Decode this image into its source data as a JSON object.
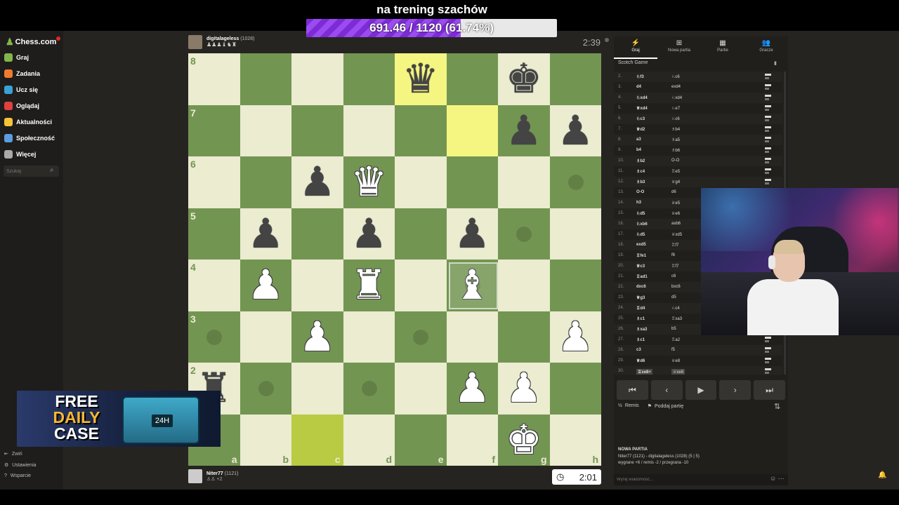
{
  "stream": {
    "title": "na trening szachów",
    "goal_text": "691.46 / 1120 (61.74%)",
    "goal_fraction": 0.6174
  },
  "sidebar": {
    "logo": "Chess.com",
    "items": [
      {
        "label": "Graj",
        "color": "#81b64c"
      },
      {
        "label": "Zadania",
        "color": "#f07b2e"
      },
      {
        "label": "Ucz się",
        "color": "#3aa1d8"
      },
      {
        "label": "Oglądaj",
        "color": "#e04040"
      },
      {
        "label": "Aktualności",
        "color": "#f6c33a"
      },
      {
        "label": "Społeczność",
        "color": "#5b9ee0"
      },
      {
        "label": "Więcej",
        "color": "#aaaaaa"
      }
    ],
    "search_placeholder": "Szukaj",
    "footer": [
      {
        "label": "Zwiń"
      },
      {
        "label": "Ustawienia"
      },
      {
        "label": "Wsparcie"
      }
    ]
  },
  "ad": {
    "line1": "FREE",
    "line2": "DAILY",
    "line3": "CASE",
    "box_label": "24H"
  },
  "top_player": {
    "name": "digitalageless",
    "rating": "(1028)",
    "clock": "2:39"
  },
  "bottom_player": {
    "name": "Niter77",
    "rating": "(1121)",
    "score": "+2",
    "clock": "2:01"
  },
  "board": {
    "ranks": [
      "8",
      "7",
      "6",
      "5",
      "4",
      "3",
      "2",
      "1"
    ],
    "files": [
      "a",
      "b",
      "c",
      "d",
      "e",
      "f",
      "g",
      "h"
    ],
    "highlights": [
      "e8",
      "f7"
    ],
    "last_highlight": [
      "c1"
    ],
    "dots": [
      "h6",
      "g5",
      "f4",
      "a3",
      "e3",
      "b2",
      "d2"
    ],
    "pieces": {
      "e8": "bq",
      "g8": "bk",
      "g7": "bp",
      "h7": "bp",
      "c6": "bp",
      "d6": "wq",
      "b5": "bp",
      "d5": "bp",
      "f5": "bp",
      "b4": "wp",
      "d4": "wr",
      "f4": "wb",
      "c3": "wp",
      "h3": "wp",
      "a2": "br",
      "f2": "wp",
      "g2": "wp",
      "g1": "wk"
    }
  },
  "panel": {
    "tabs": [
      {
        "label": "Graj",
        "icon": "⚡"
      },
      {
        "label": "Nowa partia",
        "icon": "⊞"
      },
      {
        "label": "Partie",
        "icon": "▦"
      },
      {
        "label": "Gracze",
        "icon": "👥"
      }
    ],
    "opening": "Scotch Game",
    "moves": [
      {
        "n": "2.",
        "w": "♘f3",
        "b": "♘c6"
      },
      {
        "n": "3.",
        "w": "d4",
        "b": "exd4"
      },
      {
        "n": "4.",
        "w": "♘xd4",
        "b": "♘xd4"
      },
      {
        "n": "5.",
        "w": "♕xd4",
        "b": "♘e7"
      },
      {
        "n": "6.",
        "w": "♘c3",
        "b": "♘c6"
      },
      {
        "n": "7.",
        "w": "♕d2",
        "b": "♗b4"
      },
      {
        "n": "8.",
        "w": "a3",
        "b": "♗a5"
      },
      {
        "n": "9.",
        "w": "b4",
        "b": "♗b6"
      },
      {
        "n": "10.",
        "w": "♗b2",
        "b": "O-O"
      },
      {
        "n": "11.",
        "w": "♗c4",
        "b": "♖e5"
      },
      {
        "n": "12.",
        "w": "♗b3",
        "b": "♕g4"
      },
      {
        "n": "13.",
        "w": "O-O",
        "b": "d6"
      },
      {
        "n": "14.",
        "w": "h3",
        "b": "♕e5"
      },
      {
        "n": "15.",
        "w": "♘d5",
        "b": "♕e6"
      },
      {
        "n": "16.",
        "w": "♘xb6",
        "b": "axb6"
      },
      {
        "n": "17.",
        "w": "♘d5",
        "b": "♕xd5"
      },
      {
        "n": "18.",
        "w": "exd5",
        "b": "♖f7"
      },
      {
        "n": "19.",
        "w": "♖fe1",
        "b": "f6"
      },
      {
        "n": "20.",
        "w": "♕c3",
        "b": "♖f7"
      },
      {
        "n": "21.",
        "w": "♖ad1",
        "b": "c6"
      },
      {
        "n": "22.",
        "w": "dxc6",
        "b": "bxc6"
      },
      {
        "n": "23.",
        "w": "♕g3",
        "b": "d5"
      },
      {
        "n": "24.",
        "w": "♖d4",
        "b": "♘c4"
      },
      {
        "n": "25.",
        "w": "♗c1",
        "b": "♖xa3"
      },
      {
        "n": "26.",
        "w": "♗xa3",
        "b": "b5"
      },
      {
        "n": "27.",
        "w": "♗c1",
        "b": "♖a2"
      },
      {
        "n": "28.",
        "w": "c3",
        "b": "f5"
      },
      {
        "n": "29.",
        "w": "♕d6",
        "b": "♕e8"
      },
      {
        "n": "30.",
        "w": "♖xe8+",
        "b": "♕xe8"
      }
    ],
    "actions": [
      {
        "label": "Remis",
        "icon": "½"
      },
      {
        "label": "Poddaj partię",
        "icon": "⚑"
      }
    ],
    "newgame_title": "NOWA PARTIA",
    "newgame_players": "Niter77 (1121) - digitalageless (1028) (5 | 5)",
    "newgame_stats": "wygrane +6 / remis -2 / przegrana -10",
    "chat_placeholder": "Wyślij wiadomość..."
  }
}
